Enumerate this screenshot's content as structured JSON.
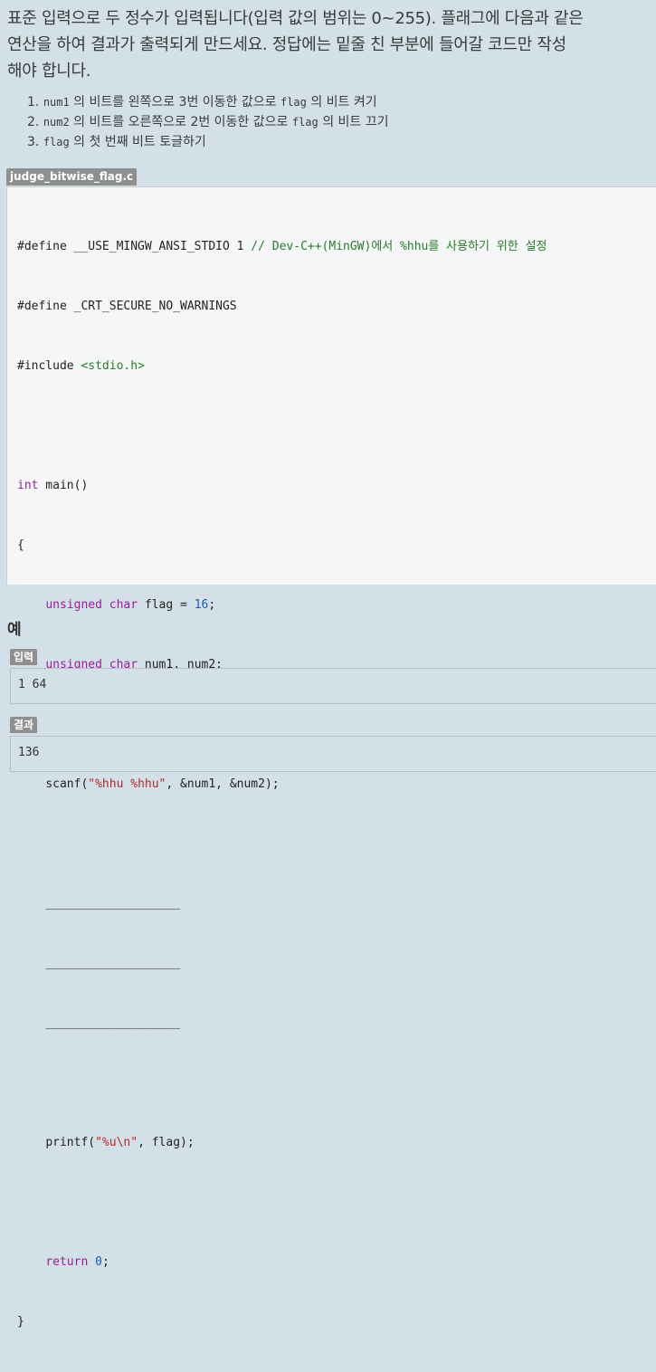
{
  "intro": {
    "line1": "표준 입력으로 두 정수가 입력됩니다(입력 값의 범위는 0~255). 플래그에 다음과 같은",
    "line2": "연산을 하여 결과가 출력되게 만드세요. 정답에는 밑줄 친 부분에 들어갈 코드만 작성",
    "line3": "해야 합니다."
  },
  "steps": [
    {
      "num": "1.",
      "var1": "num1",
      "text1": " 의 비트를 왼쪽으로 3번 이동한 값으로 ",
      "var2": "flag",
      "text2": " 의 비트 켜기"
    },
    {
      "num": "2.",
      "var1": "num2",
      "text1": " 의 비트를 오른쪽으로 2번 이동한 값으로 ",
      "var2": "flag",
      "text2": " 의 비트 끄기"
    },
    {
      "num": "3.",
      "var1": "flag",
      "text1": " 의 첫 번째 비트 토글하기",
      "var2": "",
      "text2": ""
    }
  ],
  "file_name": "judge_bitwise_flag.c",
  "code": {
    "l1_pre": "#define __USE_MINGW_ANSI_STDIO 1 ",
    "l1_comment": "// Dev-C++(MinGW)에서 %hhu를 사용하기 위한 설정",
    "l2": "#define _CRT_SECURE_NO_WARNINGS",
    "l3_pre": "#include ",
    "l3_inc": "<stdio.h>",
    "l5_kw": "int",
    "l5_rest": " main()",
    "l6": "{",
    "l7_kw1": "unsigned",
    "l7_kw2": "char",
    "l7_mid": " flag = ",
    "l7_num": "16",
    "l7_end": ";",
    "l8_kw1": "unsigned",
    "l8_kw2": "char",
    "l8_rest": " num1, num2;",
    "l10_pre": "scanf(",
    "l10_str": "\"%hhu %hhu\"",
    "l10_rest": ", &num1, &num2);",
    "blank": "___________________",
    "l16_pre": "printf(",
    "l16_str": "\"%u\\n\"",
    "l16_rest": ", flag);",
    "l18_kw": "return",
    "l18_num": "0",
    "l18_end": ";",
    "l19": "}"
  },
  "example": {
    "title": "예",
    "input_label": "입력",
    "input_value": "1 64",
    "output_label": "결과",
    "output_value": "136"
  }
}
